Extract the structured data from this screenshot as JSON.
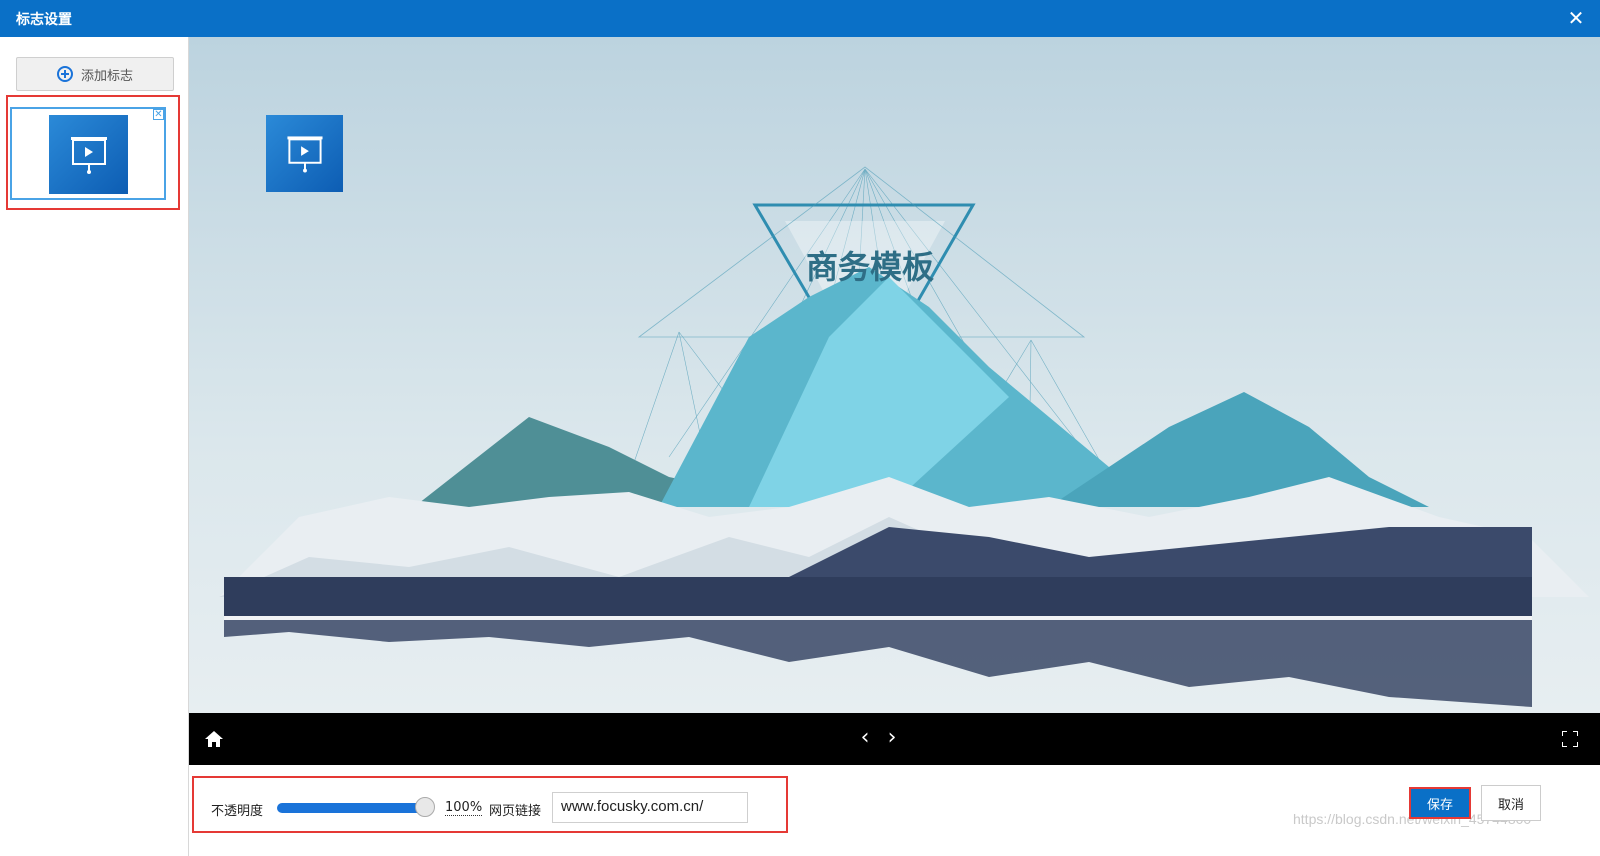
{
  "window": {
    "title": "标志设置",
    "close_label": "✕"
  },
  "sidebar": {
    "add_label": "添加标志",
    "delete_label": "✕"
  },
  "preview": {
    "title": "商务模板"
  },
  "controls": {
    "prev": "‹",
    "next": "›"
  },
  "settings": {
    "opacity_label": "不透明度",
    "opacity_value": "100%",
    "opacity_fraction": 1.0,
    "url_label": "网页链接",
    "url_value": "www.focusky.com.cn/"
  },
  "actions": {
    "save": "保存",
    "cancel": "取消"
  },
  "watermark": "https://blog.csdn.net/weixin_45744800",
  "colors": {
    "titlebar": "#0a70c7",
    "accent": "#1a73d9",
    "highlight": "#e53935"
  }
}
